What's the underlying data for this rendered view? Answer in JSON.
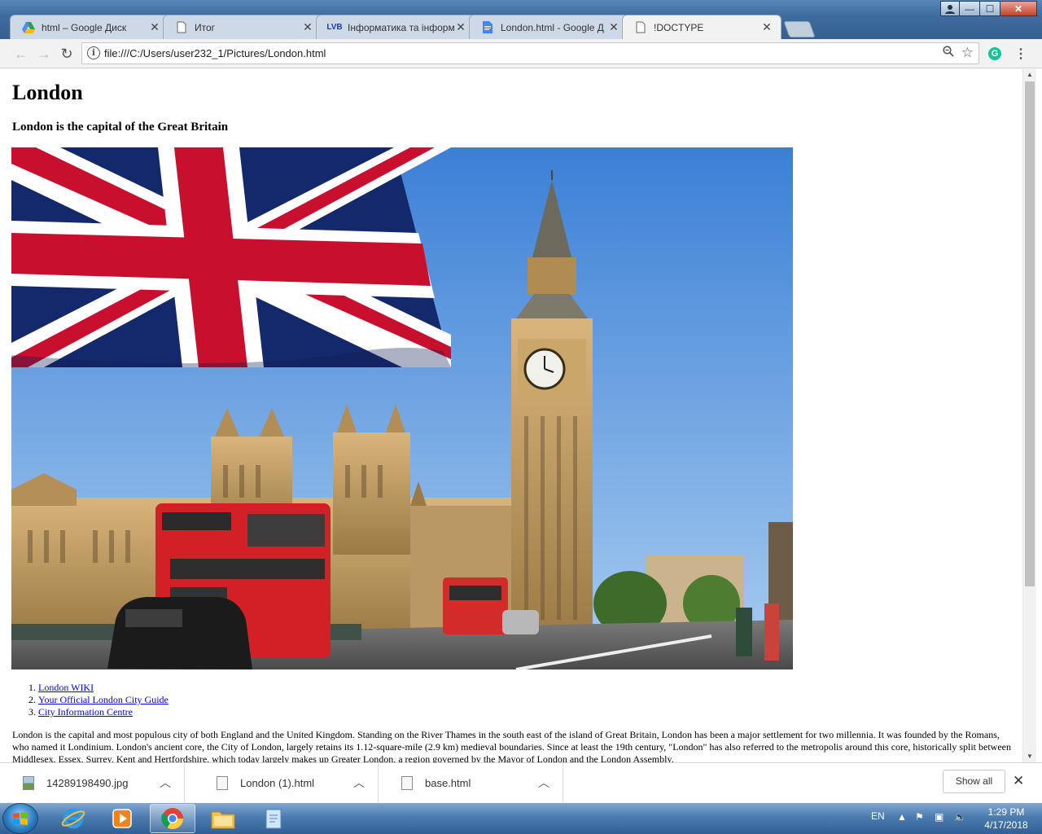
{
  "window": {
    "min": "—",
    "max": "☐",
    "close": "✕"
  },
  "tabs": [
    {
      "title": "html – Google Диск",
      "icon": "google-drive-icon"
    },
    {
      "title": "Итог",
      "icon": "document-icon"
    },
    {
      "title": "Інформатика та інформа",
      "icon": "lvb-icon"
    },
    {
      "title": "London.html - Google Д",
      "icon": "google-docs-icon"
    },
    {
      "title": "!DOCTYPE",
      "icon": "document-icon",
      "active": true
    }
  ],
  "toolbar": {
    "back": "←",
    "forward": "→",
    "reload": "↻",
    "url": "file:///C:/Users/user232_1/Pictures/London.html",
    "grammarly": "G",
    "menu": "⋮"
  },
  "page": {
    "heading": "London",
    "subheading": "London is the capital of the Great Britain",
    "links": [
      "London WIKI",
      "Your Official London City Guide",
      "City Information Centre"
    ],
    "paragraph": "London is the capital and most populous city of both England and the United Kingdom. Standing on the River Thames in the south east of the island of Great Britain, London has been a major settlement for two millennia. It was founded by the Romans, who named it Londinium. London's ancient core, the City of London, largely retains its 1.12-square-mile (2.9 km) medieval boundaries. Since at least the 19th century, \"London\" has also referred to the metropolis around this core, historically split between Middlesex, Essex, Surrey, Kent and Hertfordshire, which today largely makes up Greater London, a region governed by the Mayor of London and the London Assembly."
  },
  "downloads": {
    "items": [
      {
        "name": "14289198490.jpg",
        "type": "image"
      },
      {
        "name": "London (1).html",
        "type": "html"
      },
      {
        "name": "base.html",
        "type": "html"
      }
    ],
    "show_all": "Show all"
  },
  "taskbar": {
    "language": "EN",
    "time": "1:29 PM",
    "date": "4/17/2018"
  }
}
